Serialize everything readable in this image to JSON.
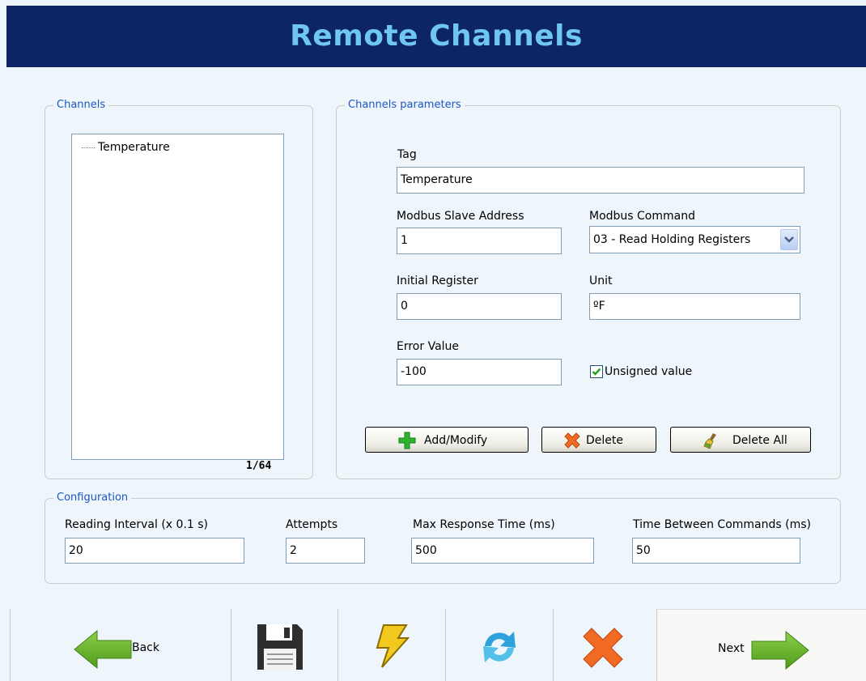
{
  "header": {
    "title": "Remote Channels"
  },
  "channels": {
    "legend": "Channels",
    "items": [
      "Temperature"
    ],
    "counter": "1/64"
  },
  "params": {
    "legend": "Channels parameters",
    "tag_label": "Tag",
    "tag_value": "Temperature",
    "slave_label": "Modbus Slave Address",
    "slave_value": "1",
    "command_label": "Modbus Command",
    "command_value": "03 - Read Holding Registers",
    "initial_label": "Initial Register",
    "initial_value": "0",
    "unit_label": "Unit",
    "unit_value": "ºF",
    "error_label": "Error Value",
    "error_value": "-100",
    "unsigned_label": "Unsigned value",
    "unsigned_checked": true,
    "add_label": "Add/Modify",
    "delete_label": "Delete",
    "delete_all_label": "Delete All"
  },
  "config": {
    "legend": "Configuration",
    "interval_label": "Reading Interval (x 0.1 s)",
    "interval_value": "20",
    "attempts_label": "Attempts",
    "attempts_value": "2",
    "max_resp_label": "Max Response Time (ms)",
    "max_resp_value": "500",
    "between_label": "Time Between Commands (ms)",
    "between_value": "50"
  },
  "nav": {
    "back_label": "Back",
    "next_label": "Next",
    "icons": [
      "back-arrow-icon",
      "save-icon",
      "lightning-icon",
      "refresh-icon",
      "close-icon",
      "next-arrow-icon"
    ]
  },
  "colors": {
    "header_bg": "#0d2566",
    "header_text": "#6ec6f1",
    "legend_text": "#1c57c4",
    "page_bg": "#eef5fb"
  }
}
